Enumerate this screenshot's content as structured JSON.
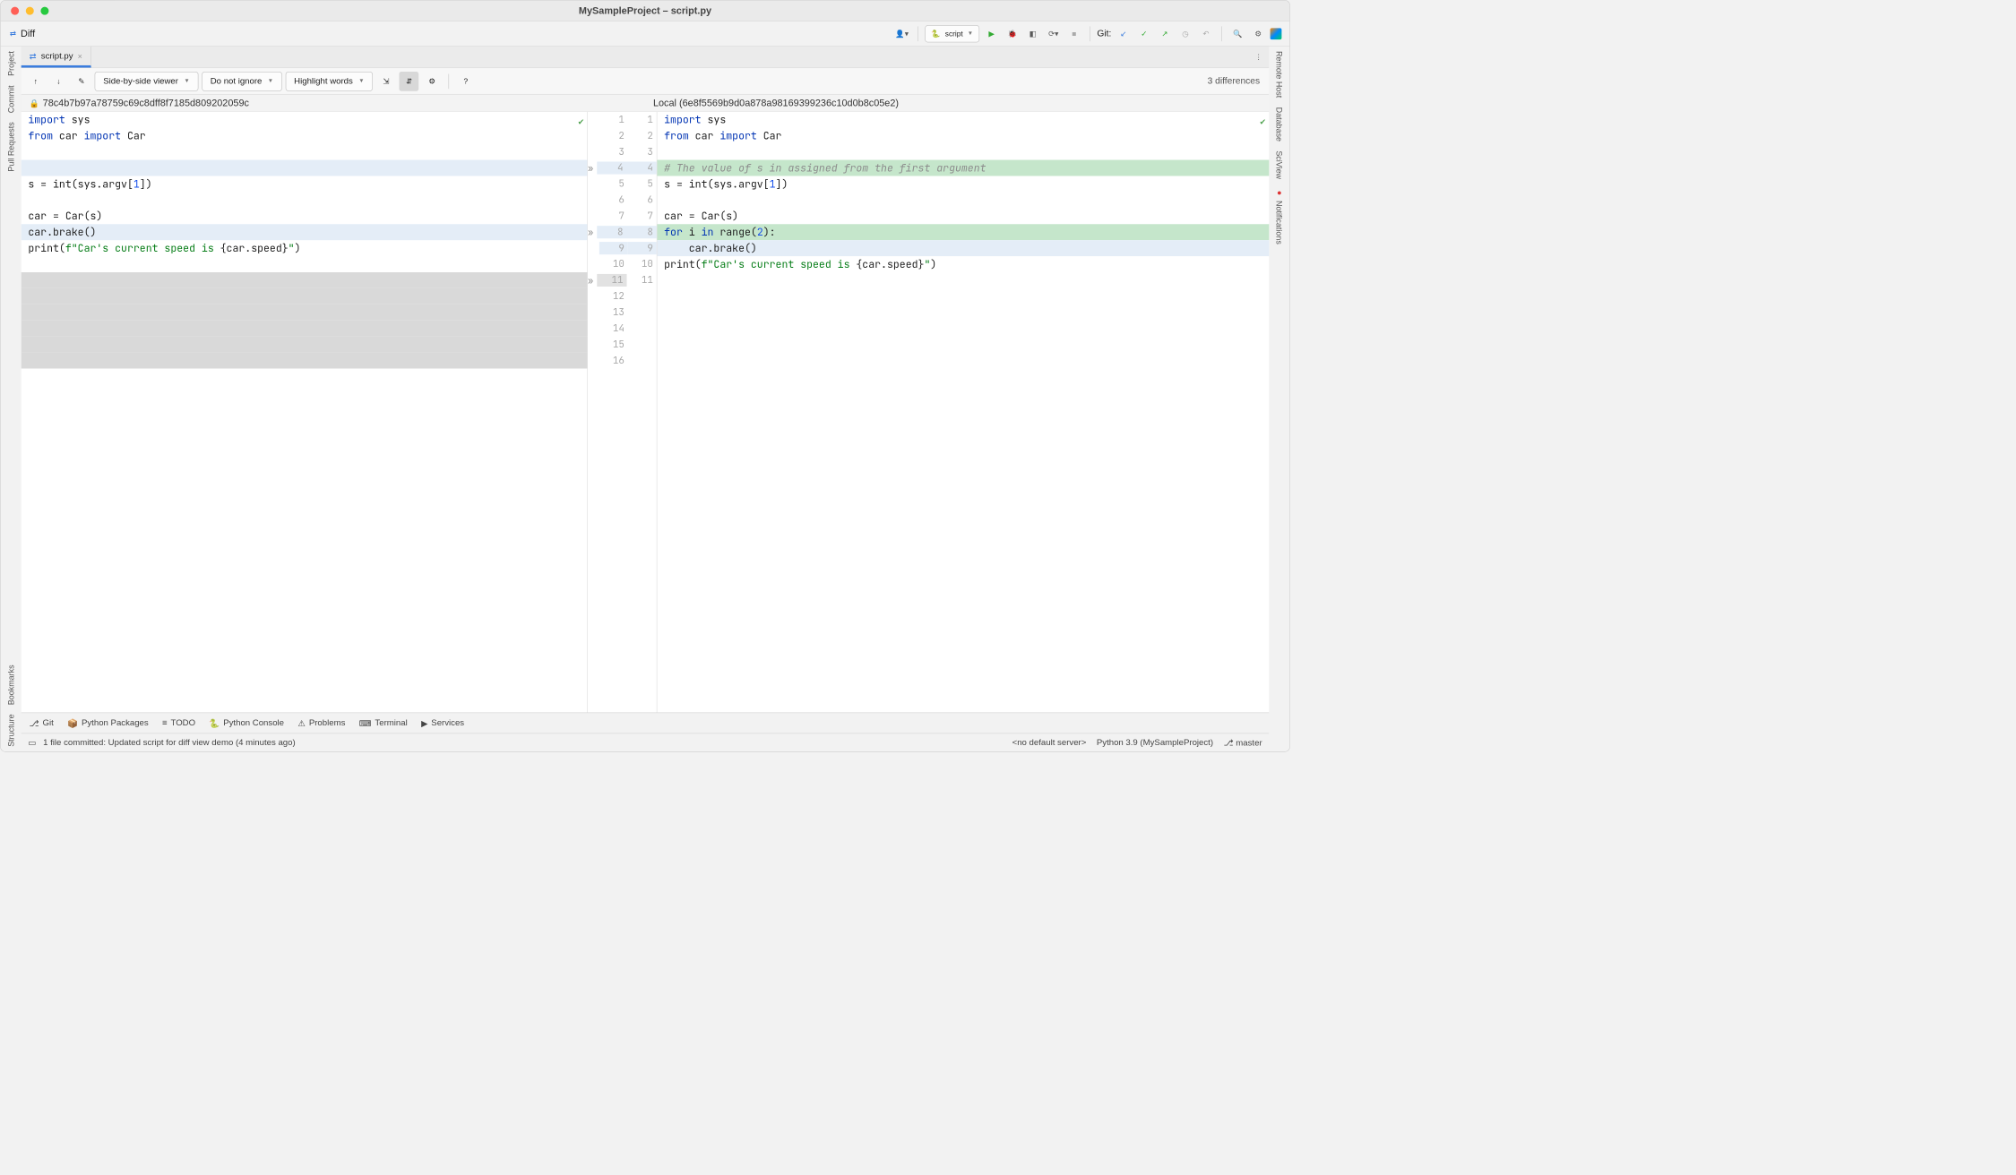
{
  "window": {
    "title": "MySampleProject – script.py"
  },
  "toolbar1": {
    "diff_label": "Diff",
    "run_config": "script",
    "git_label": "Git:"
  },
  "left_rail": [
    "Project",
    "Commit",
    "Pull Requests",
    "Bookmarks",
    "Structure"
  ],
  "right_rail": [
    "Remote Host",
    "Database",
    "SciView",
    "Notifications"
  ],
  "tab": {
    "filename": "script.py"
  },
  "diff_toolbar": {
    "viewer_mode": "Side-by-side viewer",
    "ignore_mode": "Do not ignore",
    "highlight_mode": "Highlight words",
    "help_label": "?",
    "diff_count": "3 differences"
  },
  "revisions": {
    "left_hash": "78c4b7b97a78759c69c8dff8f7185d809202059c",
    "right_label": "Local (6e8f5569b9d0a878a98169399236c10d0b8c05e2)"
  },
  "left_lines": [
    {
      "t": "import ",
      "cls": "kw",
      "rest": "sys"
    },
    {
      "raw": "from car import Car"
    },
    {
      "raw": ""
    },
    {
      "raw": "",
      "bg": "hl-lblue"
    },
    {
      "raw": "s = int(sys.argv[1])"
    },
    {
      "raw": ""
    },
    {
      "raw": "car = Car(s)"
    },
    {
      "raw": "car.brake()",
      "bg": "hl-lblue"
    },
    {
      "raw": "print(f\"Car's current speed is {car.speed}\")"
    },
    {
      "raw": ""
    }
  ],
  "right_lines": [
    {
      "raw": "import sys"
    },
    {
      "raw": "from car import Car"
    },
    {
      "raw": ""
    },
    {
      "raw": "# The value of s in assigned from the first argument",
      "bg": "hl-green",
      "comment": true
    },
    {
      "raw": "s = int(sys.argv[1])"
    },
    {
      "raw": ""
    },
    {
      "raw": "car = Car(s)"
    },
    {
      "raw": "for i in range(2):",
      "bg": "hl-green"
    },
    {
      "raw": "    car.brake()",
      "bg": "hl-lblue"
    },
    {
      "raw": "print(f\"Car's current speed is {car.speed}\")"
    },
    {
      "raw": ""
    }
  ],
  "gutter": [
    {
      "l": "1",
      "r": "1"
    },
    {
      "l": "2",
      "r": "2"
    },
    {
      "l": "3",
      "r": "3"
    },
    {
      "l": "4",
      "r": "4",
      "chev": true,
      "blue": true
    },
    {
      "l": "5",
      "r": "5"
    },
    {
      "l": "6",
      "r": "6"
    },
    {
      "l": "7",
      "r": "7"
    },
    {
      "l": "8",
      "r": "8",
      "chev": true,
      "blue": true
    },
    {
      "l": "9",
      "r": "9",
      "blue": true
    },
    {
      "l": "10",
      "r": "10"
    },
    {
      "l": "11",
      "r": "11",
      "chev": true,
      "gray": true
    },
    {
      "l": "12",
      "r": ""
    },
    {
      "l": "13",
      "r": ""
    },
    {
      "l": "14",
      "r": ""
    },
    {
      "l": "15",
      "r": ""
    },
    {
      "l": "16",
      "r": ""
    }
  ],
  "tool_windows": [
    "Git",
    "Python Packages",
    "TODO",
    "Python Console",
    "Problems",
    "Terminal",
    "Services"
  ],
  "status": {
    "commit_msg": "1 file committed: Updated script for diff view demo (4 minutes ago)",
    "server": "<no default server>",
    "interpreter": "Python 3.9 (MySampleProject)",
    "branch": "master"
  }
}
